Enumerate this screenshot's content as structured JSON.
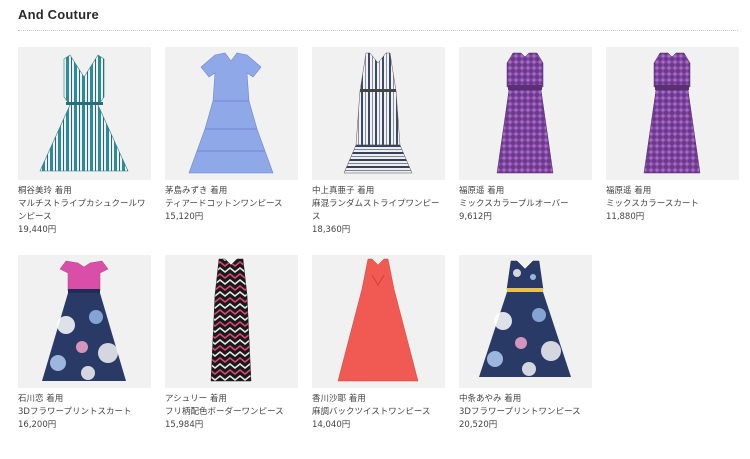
{
  "section": {
    "title": "And Couture"
  },
  "items": [
    {
      "model": "桐谷美玲 着用",
      "name": "マルチストライプカシュクールワンピース",
      "price": "19,440円",
      "icon": "striped-wrap-dress-icon"
    },
    {
      "model": "茅島みずき 着用",
      "name": "ティアードコットンワンピース",
      "price": "15,120円",
      "icon": "tiered-cotton-dress-icon"
    },
    {
      "model": "中上真亜子 着用",
      "name": "麻混ランダムストライプワンピース",
      "price": "18,360円",
      "icon": "random-stripe-dress-icon"
    },
    {
      "model": "福原遥 着用",
      "name": "ミックスカラープルオーバー",
      "price": "9,612円",
      "icon": "mix-color-pullover-icon"
    },
    {
      "model": "福原遥 着用",
      "name": "ミックスカラースカート",
      "price": "11,880円",
      "icon": "mix-color-skirt-icon"
    },
    {
      "model": "石川恋 着用",
      "name": "3Dフラワープリントスカート",
      "price": "16,200円",
      "icon": "flower-print-skirt-icon"
    },
    {
      "model": "アシュリー 着用",
      "name": "フリ柄配色ボーダーワンピース",
      "price": "15,984円",
      "icon": "zigzag-border-dress-icon"
    },
    {
      "model": "香川沙耶 着用",
      "name": "麻調バックツイストワンピース",
      "price": "14,040円",
      "icon": "back-twist-dress-icon"
    },
    {
      "model": "中条あやみ 着用",
      "name": "3Dフラワープリントワンピース",
      "price": "20,520円",
      "icon": "flower-print-dress-icon"
    }
  ]
}
